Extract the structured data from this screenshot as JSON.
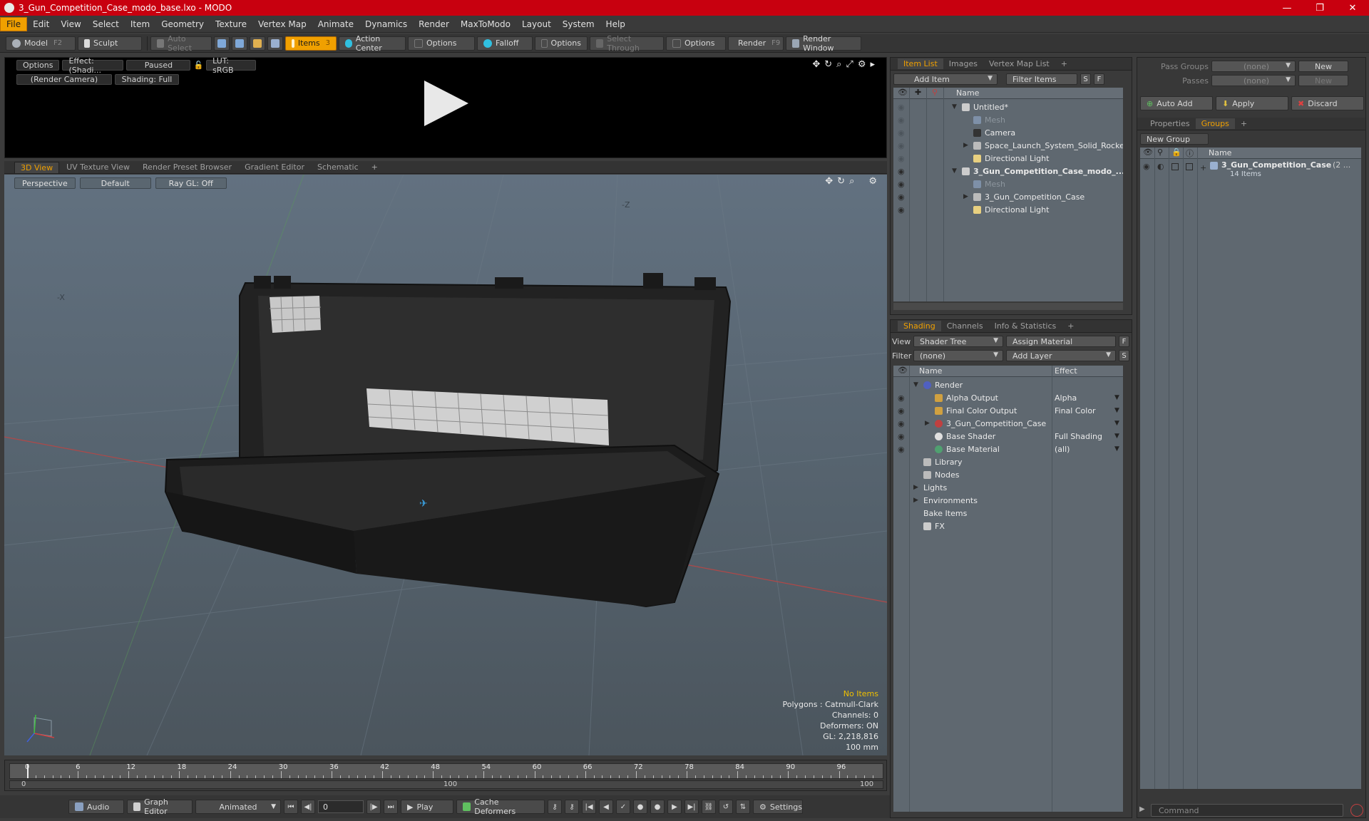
{
  "window": {
    "title": "3_Gun_Competition_Case_modo_base.lxo - MODO",
    "minimize": "—",
    "maximize": "❐",
    "close": "✕"
  },
  "menu": [
    "File",
    "Edit",
    "View",
    "Select",
    "Item",
    "Geometry",
    "Texture",
    "Vertex Map",
    "Animate",
    "Dynamics",
    "Render",
    "MaxToModo",
    "Layout",
    "System",
    "Help"
  ],
  "toolbar": {
    "model": "Model",
    "model_hotkey": "F2",
    "sculpt": "Sculpt",
    "auto_select": "Auto Select",
    "items": "Items",
    "items_hotkey": "3",
    "action_center": "Action Center",
    "options1": "Options",
    "falloff": "Falloff",
    "options2": "Options",
    "select_through": "Select Through",
    "options3": "Options",
    "render": "Render",
    "render_hotkey": "F9",
    "render_window": "Render Window"
  },
  "preview": {
    "options": "Options",
    "effect": "Effect: (Shadi...",
    "paused": "Paused",
    "lut": "LUT: sRGB",
    "camera": "(Render Camera)",
    "shading": "Shading: Full"
  },
  "viewport_tabs": [
    "3D View",
    "UV Texture View",
    "Render Preset Browser",
    "Gradient Editor",
    "Schematic"
  ],
  "viewport": {
    "perspective": "Perspective",
    "default": "Default",
    "raygl": "Ray GL: Off",
    "axis_z": "-Z",
    "axis_x": "-X",
    "info_warn": "No Items",
    "info": [
      "Polygons : Catmull-Clark",
      "Channels: 0",
      "Deformers: ON",
      "GL: 2,218,816",
      "100 mm"
    ]
  },
  "timeline": {
    "ticks": [
      "0",
      "6",
      "12",
      "18",
      "24",
      "30",
      "36",
      "42",
      "48",
      "54",
      "60",
      "66",
      "72",
      "78",
      "84",
      "90",
      "96"
    ],
    "range_start": "0",
    "range_mid": "100",
    "range_end": "100"
  },
  "bottombar": {
    "audio": "Audio",
    "graph_editor": "Graph Editor",
    "animated": "Animated",
    "frame": "0",
    "play": "Play",
    "cache_deformers": "Cache Deformers",
    "settings": "Settings"
  },
  "item_list": {
    "tabs": [
      "Item List",
      "Images",
      "Vertex Map List"
    ],
    "add_item": "Add Item",
    "filter_items": "Filter Items",
    "s": "S",
    "f": "F",
    "col_name": "Name",
    "rows": [
      {
        "label": "Untitled*",
        "style": "normal"
      },
      {
        "label": "Mesh",
        "style": "gray"
      },
      {
        "label": "Camera",
        "style": "normal"
      },
      {
        "label": "Space_Launch_System_Solid_Rocket_...",
        "style": "normal"
      },
      {
        "label": "Directional Light",
        "style": "normal"
      },
      {
        "label": "3_Gun_Competition_Case_modo_...",
        "style": "bold"
      },
      {
        "label": "Mesh",
        "style": "gray"
      },
      {
        "label": "3_Gun_Competition_Case",
        "style": "normal"
      },
      {
        "label": "Directional Light",
        "style": "normal"
      }
    ]
  },
  "shading": {
    "tabs": [
      "Shading",
      "Channels",
      "Info & Statistics"
    ],
    "view_label": "View",
    "view_value": "Shader Tree",
    "assign_material": "Assign Material",
    "f": "F",
    "filter_label": "Filter",
    "filter_value": "(none)",
    "add_layer": "Add Layer",
    "s": "S",
    "col_name": "Name",
    "col_effect": "Effect",
    "rows": [
      {
        "label": "Render",
        "effect": ""
      },
      {
        "label": "Alpha Output",
        "effect": "Alpha"
      },
      {
        "label": "Final Color Output",
        "effect": "Final Color"
      },
      {
        "label": "3_Gun_Competition_Case",
        "effect": ""
      },
      {
        "label": "Base Shader",
        "effect": "Full Shading"
      },
      {
        "label": "Base Material",
        "effect": "(all)"
      },
      {
        "label": "Library",
        "effect": ""
      },
      {
        "label": "Nodes",
        "effect": ""
      },
      {
        "label": "Lights",
        "effect": ""
      },
      {
        "label": "Environments",
        "effect": ""
      },
      {
        "label": "Bake Items",
        "effect": ""
      },
      {
        "label": "FX",
        "effect": ""
      }
    ]
  },
  "groups": {
    "pass_groups_label": "Pass Groups",
    "pass_groups_value": "(none)",
    "new1": "New",
    "passes_label": "Passes",
    "passes_value": "(none)",
    "new2": "New",
    "auto_add": "Auto Add",
    "apply": "Apply",
    "discard": "Discard",
    "tabs": [
      "Properties",
      "Groups"
    ],
    "new_group": "New Group",
    "col_name": "Name",
    "group_name": "3_Gun_Competition_Case",
    "group_count": "(2 ...",
    "group_items": "14 Items"
  },
  "command_placeholder": "Command",
  "colors": {
    "accent": "#f0a000",
    "titlebar": "#c8000f"
  }
}
